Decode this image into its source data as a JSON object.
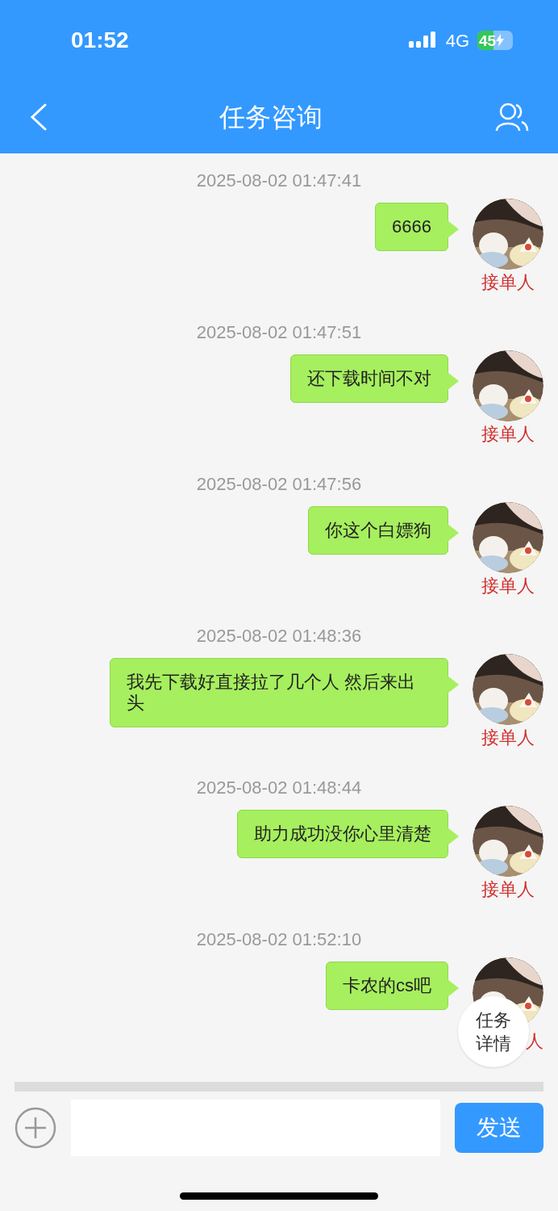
{
  "status_bar": {
    "time": "01:52",
    "network": "4G",
    "battery": "45",
    "charging": true
  },
  "nav": {
    "title": "任务咨询"
  },
  "messages": [
    {
      "time": "2025-08-02 01:47:41",
      "text": "6666",
      "role": "接单人"
    },
    {
      "time": "2025-08-02 01:47:51",
      "text": "还下载时间不对",
      "role": "接单人"
    },
    {
      "time": "2025-08-02 01:47:56",
      "text": "你这个白嫖狗",
      "role": "接单人"
    },
    {
      "time": "2025-08-02 01:48:36",
      "text": "我先下载好直接拉了几个人 然后来出头",
      "role": "接单人"
    },
    {
      "time": "2025-08-02 01:48:44",
      "text": "助力成功没你心里清楚",
      "role": "接单人"
    },
    {
      "time": "2025-08-02 01:52:10",
      "text": "卡农的cs吧",
      "role": "人"
    }
  ],
  "floating_button": {
    "label_lines": [
      "任务",
      "详情"
    ]
  },
  "composer": {
    "send": "发送"
  }
}
